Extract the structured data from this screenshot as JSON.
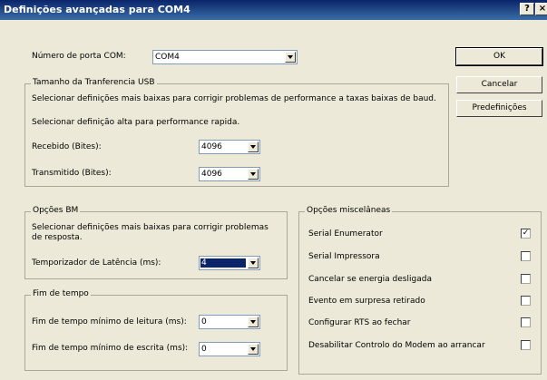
{
  "window": {
    "title": "Definições avançadas para COM4",
    "help_button": "?",
    "close_button": "×"
  },
  "com_port": {
    "label": "Número de porta COM:",
    "value": "COM4"
  },
  "buttons": {
    "ok": "OK",
    "cancel": "Cancelar",
    "defaults": "Predefinições"
  },
  "usb_transfer": {
    "title": "Tamanho da Tranferencia USB",
    "hint_low": "Selecionar definições mais baixas para corrigir problemas de performance a taxas baixas de baud.",
    "hint_high": "Selecionar definição alta para performance rapida.",
    "receive_label": "Recebido (Bites):",
    "receive_value": "4096",
    "transmit_label": "Transmitido (Bites):",
    "transmit_value": "4096"
  },
  "bm_options": {
    "title": "Opções BM",
    "hint_line1": "Selecionar definições mais baixas para corrigir problemas",
    "hint_line2": "de resposta.",
    "latency_label": "Temporizador de Latência (ms):",
    "latency_value": "4"
  },
  "timeouts": {
    "title": "Fim de tempo",
    "read_label": "Fim de tempo mínimo de leitura (ms):",
    "read_value": "0",
    "write_label": "Fim de tempo mínimo de escrita (ms):",
    "write_value": "0"
  },
  "misc_options": {
    "title": "Opções miscelâneas",
    "items": [
      {
        "label": "Serial Enumerator",
        "checked": true
      },
      {
        "label": "Serial Impressora",
        "checked": false
      },
      {
        "label": "Cancelar se energia desligada",
        "checked": false
      },
      {
        "label": "Evento em surpresa retirado",
        "checked": false
      },
      {
        "label": "Configurar RTS ao fechar",
        "checked": false
      },
      {
        "label": "Desabilitar Controlo do Modem ao arrancar",
        "checked": false
      }
    ]
  }
}
